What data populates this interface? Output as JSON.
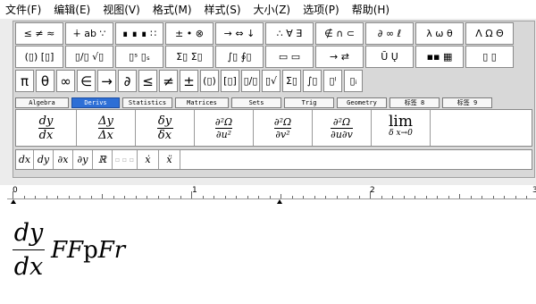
{
  "menu": [
    "文件(F)",
    "编辑(E)",
    "视图(V)",
    "格式(M)",
    "样式(S)",
    "大小(Z)",
    "选项(P)",
    "帮助(H)"
  ],
  "symbols_row1": [
    "≤ ≠ ≈",
    "∔ ab ∵",
    "∎ ∎ ∎ ∷",
    "± • ⊗",
    "→ ⇔ ↓",
    "∴ ∀ ∃",
    "∉ ∩ ⊂",
    "∂ ∞ ℓ",
    "λ ω θ",
    "Λ Ω Θ"
  ],
  "symbols_row2": [
    "(▯) [▯]",
    "▯/▯ √▯",
    "▯ˢ ▯ₛ",
    "Σ▯ Σ▯",
    "∫▯ ∮▯",
    "▭ ▭",
    "→ ⇄",
    "Ū Ų",
    "▪▪ ▦",
    "▯ ▯"
  ],
  "symbols_row3": [
    "π",
    "θ",
    "∞",
    "∈",
    "→",
    "∂",
    "≤",
    "≠",
    "±",
    "(▯)",
    "[▯]",
    "▯/▯",
    "▯√",
    "Σ▯",
    "∫▯",
    "▯ˡ",
    "▯ᵢ"
  ],
  "tabs": [
    "Algebra",
    "Derivs",
    "Statistics",
    "Matrices",
    "Sets",
    "Trig",
    "Geometry",
    "标签 8",
    "标签 9"
  ],
  "templates": [
    {
      "num": "dy",
      "den": "dx"
    },
    {
      "num": "Δy",
      "den": "Δx"
    },
    {
      "num": "δy",
      "den": "δx"
    },
    {
      "num": "∂²Ω",
      "den": "∂u²"
    },
    {
      "num": "∂²Ω",
      "den": "∂v²"
    },
    {
      "num": "∂²Ω",
      "den": "∂u∂v"
    },
    {
      "word": "lim",
      "sub": "δ x→0"
    }
  ],
  "small_templates": [
    "dx",
    "dy",
    "∂x",
    "∂y",
    "ℝ",
    "▫ ▫ ▫",
    "ẋ",
    "ẍ"
  ],
  "size_toggles": [
    "t",
    "↑",
    "↑",
    "↑"
  ],
  "ruler_labels": [
    "0",
    "1",
    "2",
    "3"
  ],
  "editor": {
    "num": "dy",
    "den": "dx",
    "tail_1": "FF",
    "tail_2": "p",
    "tail_3": "Fr"
  }
}
